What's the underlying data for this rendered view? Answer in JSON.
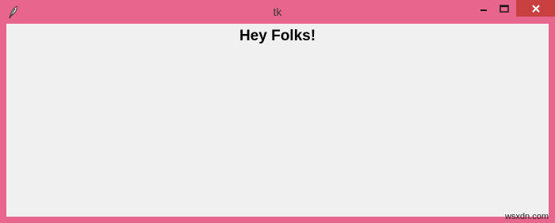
{
  "window": {
    "title": "tk",
    "frame_color": "#e8668e",
    "close_color": "#c94040",
    "client_background": "#f0f0f0",
    "app_icon": "feather-icon"
  },
  "main": {
    "label_text": "Hey Folks!"
  },
  "watermark": {
    "text": "wsxdn.com"
  }
}
